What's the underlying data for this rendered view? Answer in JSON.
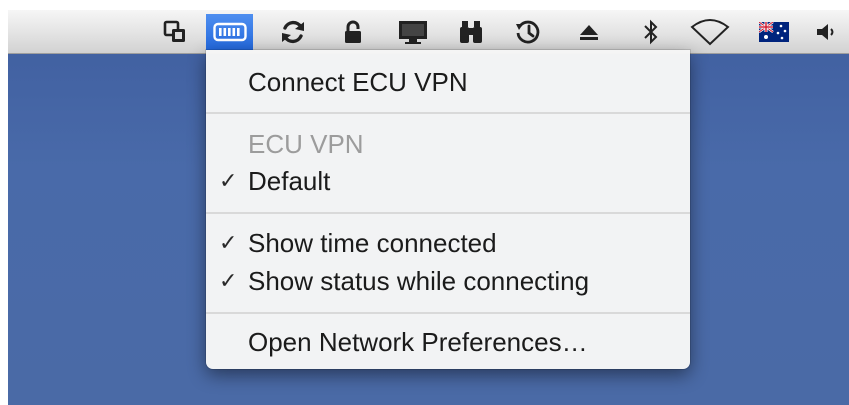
{
  "menubar": {
    "extras": [
      {
        "icon": "window-switch-icon"
      },
      {
        "icon": "vpn-icon",
        "active": true
      },
      {
        "icon": "sync-icon"
      },
      {
        "icon": "lock-icon"
      },
      {
        "icon": "display-icon"
      },
      {
        "icon": "binoculars-icon"
      },
      {
        "icon": "time-machine-icon"
      },
      {
        "icon": "eject-icon"
      },
      {
        "icon": "bluetooth-icon"
      },
      {
        "icon": "wifi-icon"
      },
      {
        "icon": "australia-flag-icon"
      },
      {
        "icon": "volume-icon"
      }
    ]
  },
  "vpn_menu": {
    "connect_label": "Connect ECU VPN",
    "config_header": "ECU VPN",
    "default_label": "Default",
    "default_checked": true,
    "show_time_label": "Show time connected",
    "show_time_checked": true,
    "show_status_label": "Show status while connecting",
    "show_status_checked": true,
    "open_prefs_label": "Open Network Preferences…",
    "check_glyph": "✓"
  },
  "colors": {
    "desktop": "#4a6aa6",
    "active_highlight": "#2d6fe0",
    "disabled_text": "#9c9c9c"
  }
}
